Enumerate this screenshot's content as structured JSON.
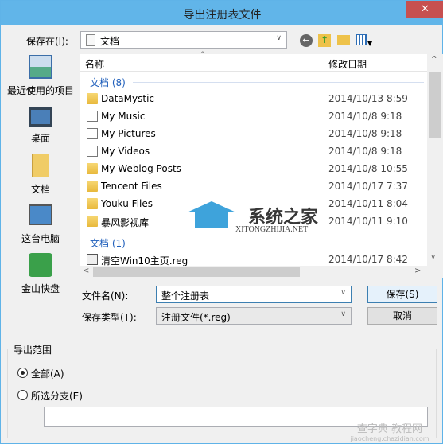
{
  "window": {
    "title": "导出注册表文件",
    "close_label": "✕"
  },
  "save_in": {
    "label": "保存在(I):",
    "value": "文档"
  },
  "toolbar": {
    "back_icon": "back-icon",
    "up_icon": "up-folder-icon",
    "new_folder_icon": "new-folder-icon",
    "view_icon": "view-menu-icon"
  },
  "places": [
    {
      "label": "最近使用的项目",
      "icon": "recent-icon"
    },
    {
      "label": "桌面",
      "icon": "desktop-icon"
    },
    {
      "label": "文档",
      "icon": "documents-icon"
    },
    {
      "label": "这台电脑",
      "icon": "computer-icon"
    },
    {
      "label": "金山快盘",
      "icon": "kuaipan-icon"
    }
  ],
  "list": {
    "columns": [
      "名称",
      "修改日期"
    ],
    "groups": [
      {
        "label": "文档 (8)",
        "items": [
          {
            "name": "DataMystic",
            "date": "2014/10/13 8:59",
            "icon": "folder-icon"
          },
          {
            "name": "My Music",
            "date": "2014/10/8 9:18",
            "icon": "shortcut-icon"
          },
          {
            "name": "My Pictures",
            "date": "2014/10/8 9:18",
            "icon": "shortcut-icon"
          },
          {
            "name": "My Videos",
            "date": "2014/10/8 9:18",
            "icon": "shortcut-icon"
          },
          {
            "name": "My Weblog Posts",
            "date": "2014/10/8 10:55",
            "icon": "folder-icon"
          },
          {
            "name": "Tencent Files",
            "date": "2014/10/17 7:37",
            "icon": "folder-icon"
          },
          {
            "name": "Youku Files",
            "date": "2014/10/11 8:04",
            "icon": "folder-icon"
          },
          {
            "name": "暴风影视库",
            "date": "2014/10/11 9:10",
            "icon": "folder-icon"
          }
        ]
      },
      {
        "label": "文档 (1)",
        "items": [
          {
            "name": "清空Win10主页.reg",
            "date": "2014/10/17 8:42",
            "icon": "reg-file-icon"
          }
        ]
      }
    ]
  },
  "filename": {
    "label": "文件名(N):",
    "value": "整个注册表"
  },
  "filetype": {
    "label": "保存类型(T):",
    "value": "注册文件(*.reg)"
  },
  "buttons": {
    "save": "保存(S)",
    "cancel": "取消"
  },
  "export_range": {
    "title": "导出范围",
    "all": "全部(A)",
    "selected": "所选分支(E)",
    "all_checked": true,
    "branch_value": ""
  },
  "watermarks": {
    "main": "系统之家",
    "sub": "XITONGZHIJIA.NET",
    "corner": "查字典 教程网",
    "corner_url": "jiaocheng.chazidian.com"
  },
  "colors": {
    "titlebar": "#61b5e9",
    "close": "#c75050",
    "group": "#1e5ebb"
  }
}
